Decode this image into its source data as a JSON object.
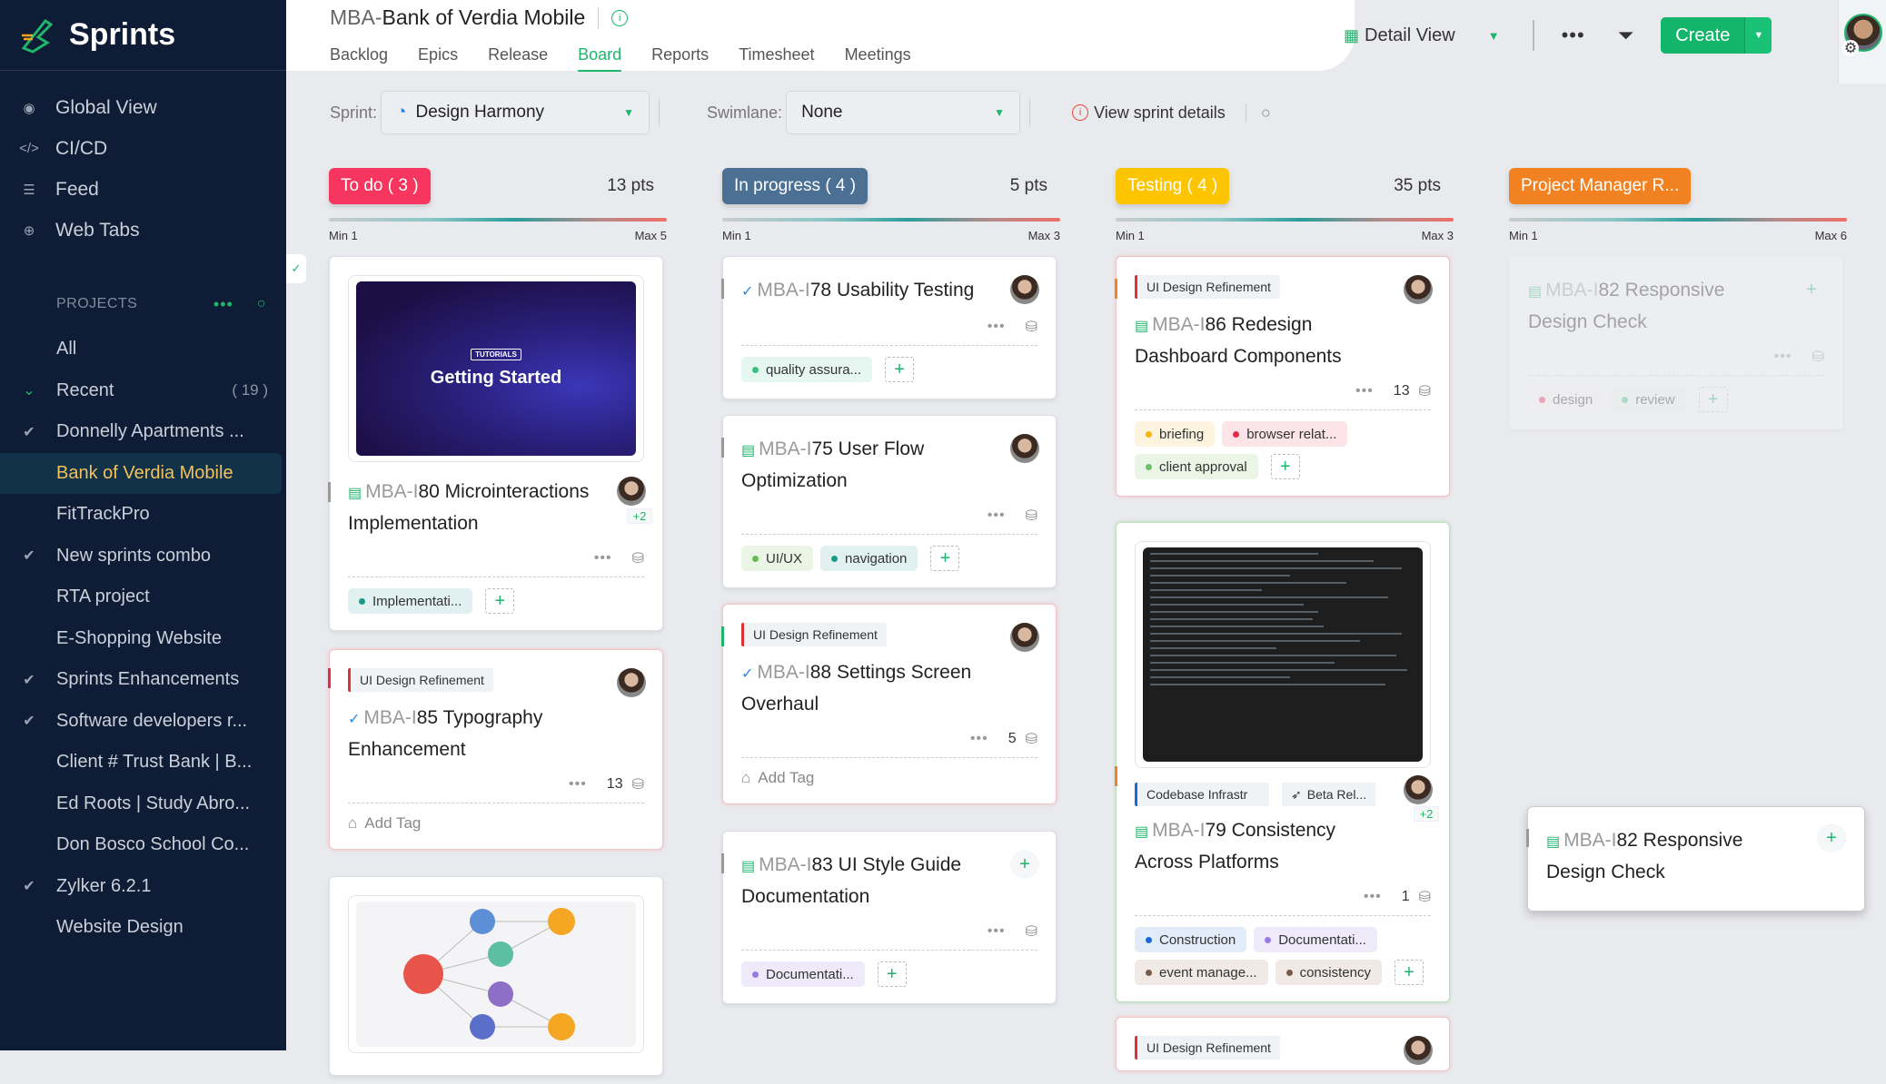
{
  "app": {
    "name": "Sprints"
  },
  "sidebar": {
    "nav": [
      {
        "label": "Global View",
        "icon": "eye-icon"
      },
      {
        "label": "CI/CD",
        "icon": "code-icon"
      },
      {
        "label": "Feed",
        "icon": "feed-icon"
      },
      {
        "label": "Web Tabs",
        "icon": "globe-icon"
      }
    ],
    "projects_heading": "PROJECTS",
    "projects": [
      {
        "label": "All",
        "icon": ""
      },
      {
        "label": "Recent",
        "icon": "chevron-down-icon",
        "count": "( 19 )"
      },
      {
        "label": "Donnelly Apartments ...",
        "icon": "sync-check-icon"
      },
      {
        "label": "Bank of Verdia Mobile",
        "icon": "",
        "active": true
      },
      {
        "label": "FitTrackPro",
        "icon": ""
      },
      {
        "label": "New sprints combo",
        "icon": "double-check-icon"
      },
      {
        "label": "RTA project",
        "icon": ""
      },
      {
        "label": "E-Shopping Website",
        "icon": ""
      },
      {
        "label": "Sprints Enhancements",
        "icon": "double-check-icon"
      },
      {
        "label": "Software developers r...",
        "icon": "double-check-icon"
      },
      {
        "label": "Client # Trust Bank | B...",
        "icon": ""
      },
      {
        "label": "Ed Roots | Study Abro...",
        "icon": ""
      },
      {
        "label": "Don Bosco School Co...",
        "icon": ""
      },
      {
        "label": "Zylker 6.2.1",
        "icon": "double-check-icon"
      },
      {
        "label": "Website Design",
        "icon": ""
      }
    ]
  },
  "header": {
    "prefix": "MBA-",
    "project": "Bank of Verdia Mobile",
    "tabs": [
      "Backlog",
      "Epics",
      "Release",
      "Board",
      "Reports",
      "Timesheet",
      "Meetings"
    ],
    "active_tab": "Board",
    "view": "Detail View",
    "create": "Create"
  },
  "filters": {
    "sprint_label": "Sprint:",
    "sprint_value": "Design Harmony",
    "swimlane_label": "Swimlane:",
    "swimlane_value": "None",
    "view_sprint_details": "View sprint details"
  },
  "columns": [
    {
      "label": "To do ( 3 )",
      "pts": "13 pts",
      "min": "Min 1",
      "max": "Max 5",
      "color": "#f7365f"
    },
    {
      "label": "In progress ( 4 )",
      "pts": "5 pts",
      "min": "Min 1",
      "max": "Max 3",
      "color": "#4c7094"
    },
    {
      "label": "Testing ( 4 )",
      "pts": "35 pts",
      "min": "Min 1",
      "max": "Max 3",
      "color": "#fdc500"
    },
    {
      "label": "Project Manager R...",
      "pts": "",
      "min": "Min 1",
      "max": "Max 6",
      "color": "#f28221"
    }
  ],
  "cards": {
    "c80": {
      "thumb_label": "TUTORIALS",
      "thumb_title": "Getting Started",
      "key": "MBA-I",
      "num": "80",
      "title": "Microinteractions Implementation",
      "extra_assignees": "+2",
      "tags": [
        {
          "label": "Implementati...",
          "dot": "#1a9a8a",
          "bg": "#e1f1f0"
        }
      ]
    },
    "c85": {
      "epic": "UI Design Refinement",
      "key": "MBA-I",
      "num": "85",
      "title": "Typography Enhancement",
      "points": "13",
      "add_tag": "Add Tag"
    },
    "c78": {
      "key": "MBA-I",
      "num": "78",
      "title": "Usability Testing",
      "tags": [
        {
          "label": "quality assura...",
          "dot": "#3dbf7f",
          "bg": "#e6f6f0"
        }
      ]
    },
    "c75": {
      "key": "MBA-I",
      "num": "75",
      "title": "User Flow Optimization",
      "tags": [
        {
          "label": "UI/UX",
          "dot": "#66bb55",
          "bg": "#eaf5e6"
        },
        {
          "label": "navigation",
          "dot": "#1a9a8a",
          "bg": "#e1f1f0"
        }
      ]
    },
    "c88": {
      "epic": "UI Design Refinement",
      "key": "MBA-I",
      "num": "88",
      "title": "Settings Screen Overhaul",
      "points": "5",
      "add_tag": "Add Tag"
    },
    "c83": {
      "key": "MBA-I",
      "num": "83",
      "title": "UI Style Guide Documentation",
      "tags": [
        {
          "label": "Documentati...",
          "dot": "#9a7ae0",
          "bg": "#eeeaf9"
        }
      ]
    },
    "c86": {
      "epic": "UI Design Refinement",
      "key": "MBA-I",
      "num": "86",
      "title": "Redesign Dashboard Components",
      "points": "13",
      "tags": [
        {
          "label": "briefing",
          "dot": "#f5b800",
          "bg": "#fdf4df"
        },
        {
          "label": "browser relat...",
          "dot": "#e8294a",
          "bg": "#fde4e8"
        },
        {
          "label": "client approval",
          "dot": "#6cc06a",
          "bg": "#eaf5e6"
        }
      ]
    },
    "c79": {
      "epic": "Codebase Infrastr",
      "release": "Beta Rel...",
      "key": "MBA-I",
      "num": "79",
      "title": "Consistency Across Platforms",
      "points": "1",
      "extra_assignees": "+2",
      "tags": [
        {
          "label": "Construction",
          "dot": "#1a6ad6",
          "bg": "#e2ecf9"
        },
        {
          "label": "Documentati...",
          "dot": "#9a7ae0",
          "bg": "#eeeaf9"
        },
        {
          "label": "event manage...",
          "dot": "#7a5a48",
          "bg": "#f0e9e6"
        },
        {
          "label": "consistency",
          "dot": "#7a5a48",
          "bg": "#f0e9e6"
        }
      ]
    },
    "c_next": {
      "epic": "UI Design Refinement"
    },
    "c82ghost": {
      "key": "MBA-I",
      "num": "82",
      "title": "Responsive Design Check",
      "tags": [
        {
          "label": "design",
          "dot": "#e8294a",
          "bg": "#f5f0f0"
        },
        {
          "label": "review",
          "dot": "#3dbf7f",
          "bg": "#eef5ef"
        }
      ]
    },
    "c82drag": {
      "key": "MBA-I",
      "num": "82",
      "title": "Responsive Design Check"
    }
  }
}
